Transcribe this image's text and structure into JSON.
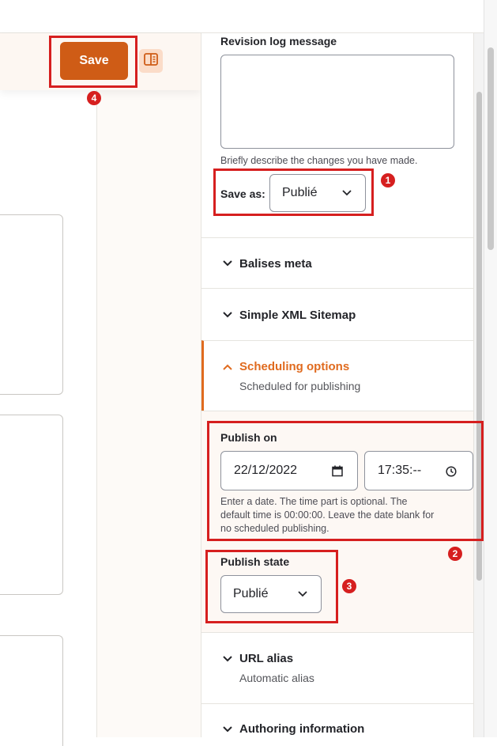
{
  "actions": {
    "save_label": "Save"
  },
  "sidebar": {
    "revision_label": "Revision log message",
    "revision_value": "",
    "revision_description": "Briefly describe the changes you have made.",
    "save_as_label": "Save as:",
    "save_as_value": "Publié",
    "sections": {
      "meta_tags": "Balises meta",
      "xml_sitemap": "Simple XML Sitemap",
      "scheduling_title": "Scheduling options",
      "scheduling_summary": "Scheduled for publishing",
      "url_alias_title": "URL alias",
      "url_alias_summary": "Automatic alias",
      "authoring_title": "Authoring information"
    },
    "scheduling": {
      "publish_on_label": "Publish on",
      "date_value": "22/12/2022",
      "time_value": "17:35:--",
      "help_text_1": "Enter a date. The time part is optional. The",
      "help_text_2": "default time is 00:00:00. Leave the date blank for",
      "help_text_3": "no scheduled publishing.",
      "publish_state_label": "Publish state",
      "publish_state_value": "Publié"
    }
  },
  "annotations": {
    "badge_1": "1",
    "badge_2": "2",
    "badge_3": "3",
    "badge_4": "4"
  },
  "colors": {
    "accent": "#cf5c16",
    "accent_text": "#e06b1f",
    "highlight": "#d61f1f"
  }
}
